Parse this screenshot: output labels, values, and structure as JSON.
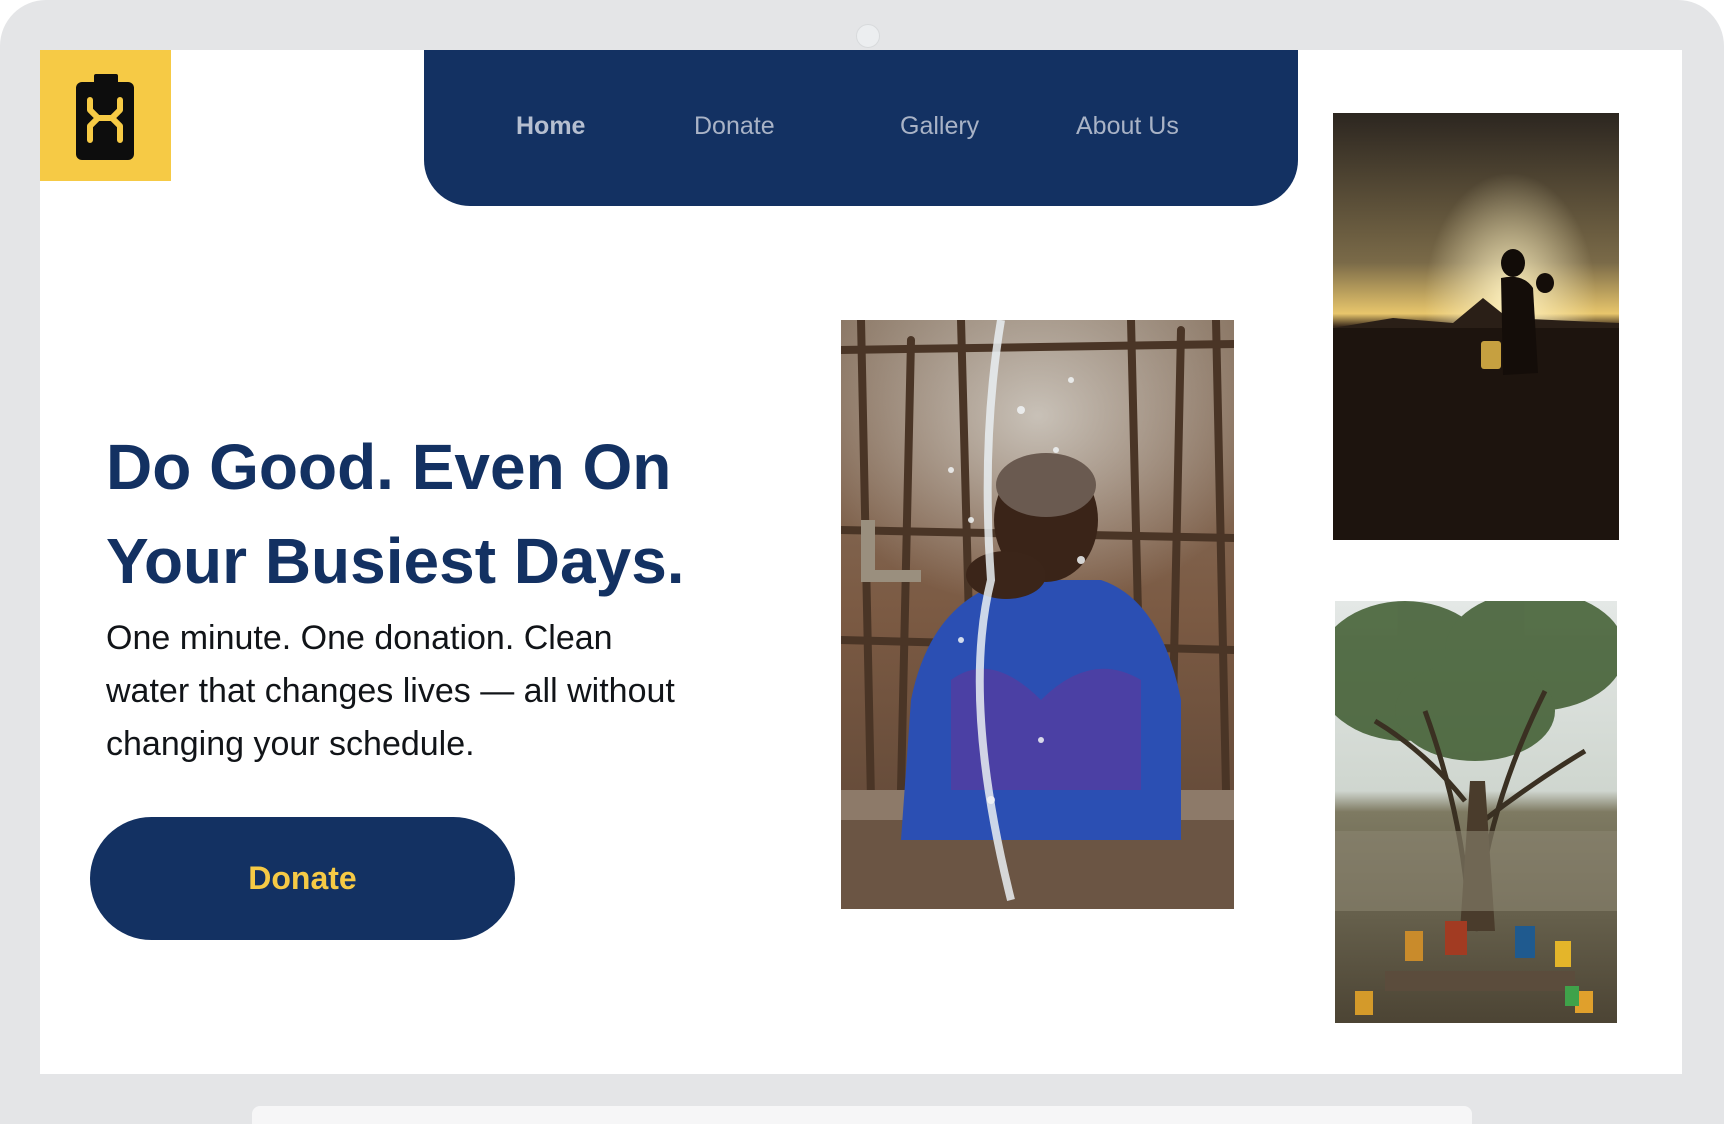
{
  "brand": {
    "logo_icon": "jerrycan-icon",
    "logo_bg": "#f6ca45",
    "primary": "#133162"
  },
  "nav": {
    "items": [
      {
        "label": "Home",
        "active": true
      },
      {
        "label": "Donate",
        "active": false
      },
      {
        "label": "Gallery",
        "active": false
      },
      {
        "label": "About Us",
        "active": false
      }
    ]
  },
  "hero": {
    "headline_line1": "Do Good. Even On",
    "headline_line2": "Your Busiest Days.",
    "subtext_line1": "One minute. One donation. Clean",
    "subtext_line2": "water that changes lives — all without",
    "subtext_line3": "changing your schedule.",
    "cta_label": "Donate"
  },
  "gallery": {
    "images": [
      {
        "icon": "child-water-photo"
      },
      {
        "icon": "sunset-silhouette-photo"
      },
      {
        "icon": "tree-water-point-photo"
      }
    ]
  }
}
